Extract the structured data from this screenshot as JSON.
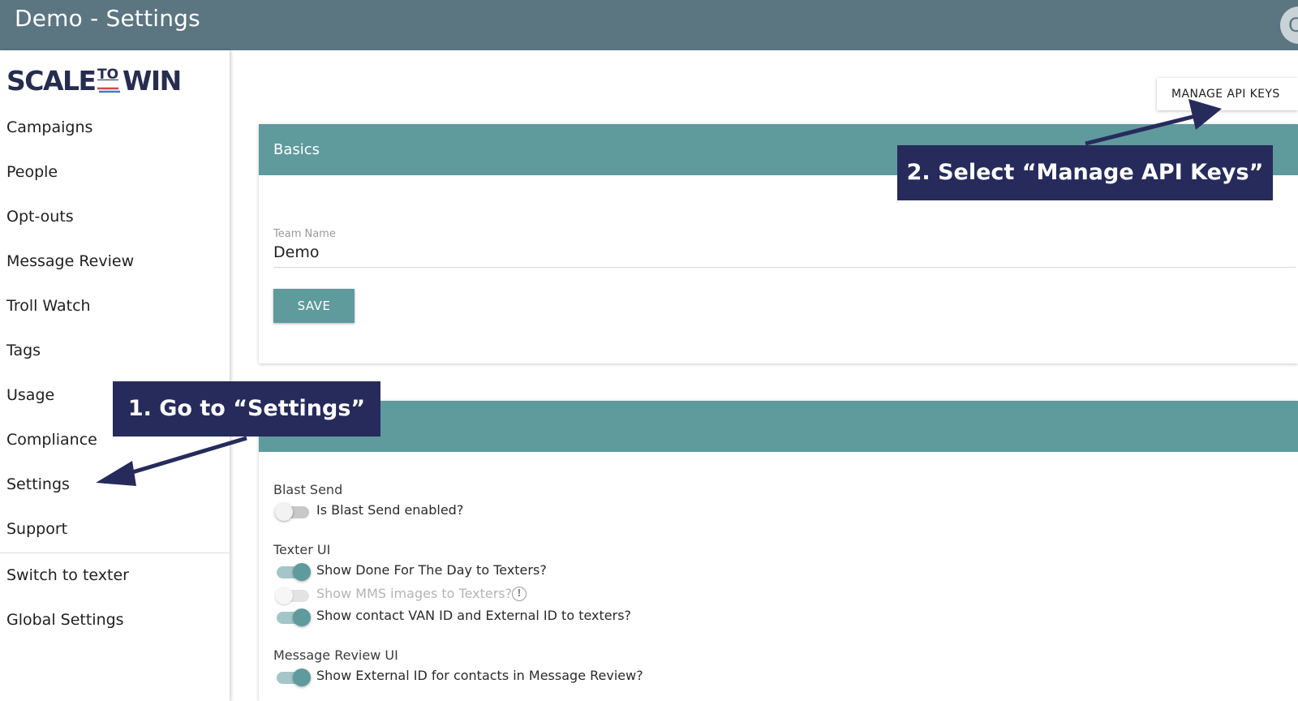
{
  "app": {
    "title": "Demo - Settings",
    "avatar_initial": "C"
  },
  "logo": {
    "part1": "SCALE",
    "part2": "TO",
    "part3": "WIN"
  },
  "sidebar": {
    "items": [
      {
        "label": "Campaigns"
      },
      {
        "label": "People"
      },
      {
        "label": "Opt-outs"
      },
      {
        "label": "Message Review"
      },
      {
        "label": "Troll Watch"
      },
      {
        "label": "Tags"
      },
      {
        "label": "Usage"
      },
      {
        "label": "Compliance"
      },
      {
        "label": "Settings"
      },
      {
        "label": "Support"
      }
    ],
    "secondary_items": [
      {
        "label": "Switch to texter"
      },
      {
        "label": "Global Settings"
      }
    ]
  },
  "toolbar": {
    "manage_api_keys": "MANAGE API KEYS"
  },
  "basics": {
    "title": "Basics",
    "team_name_label": "Team Name",
    "team_name_value": "Demo",
    "save_label": "SAVE"
  },
  "features": {
    "title": "",
    "blast_send": {
      "heading": "Blast Send",
      "toggle_label": "Is Blast Send enabled?",
      "enabled": false
    },
    "texter_ui": {
      "heading": "Texter UI",
      "toggles": [
        {
          "label": "Show Done For The Day to Texters?",
          "enabled": true,
          "disabled": false
        },
        {
          "label": "Show MMS images to Texters?",
          "enabled": false,
          "disabled": true
        },
        {
          "label": "Show contact VAN ID and External ID to texters?",
          "enabled": true,
          "disabled": false
        }
      ]
    },
    "message_review_ui": {
      "heading": "Message Review UI",
      "toggle_label": "Show External ID for contacts in Message Review?",
      "enabled": true
    }
  },
  "callouts": {
    "step1": "1. Go to “Settings”",
    "step2": "2. Select “Manage API Keys”"
  },
  "colors": {
    "topbar": "#5b7581",
    "accent": "#5f9a9d",
    "callout": "#262b5c"
  }
}
